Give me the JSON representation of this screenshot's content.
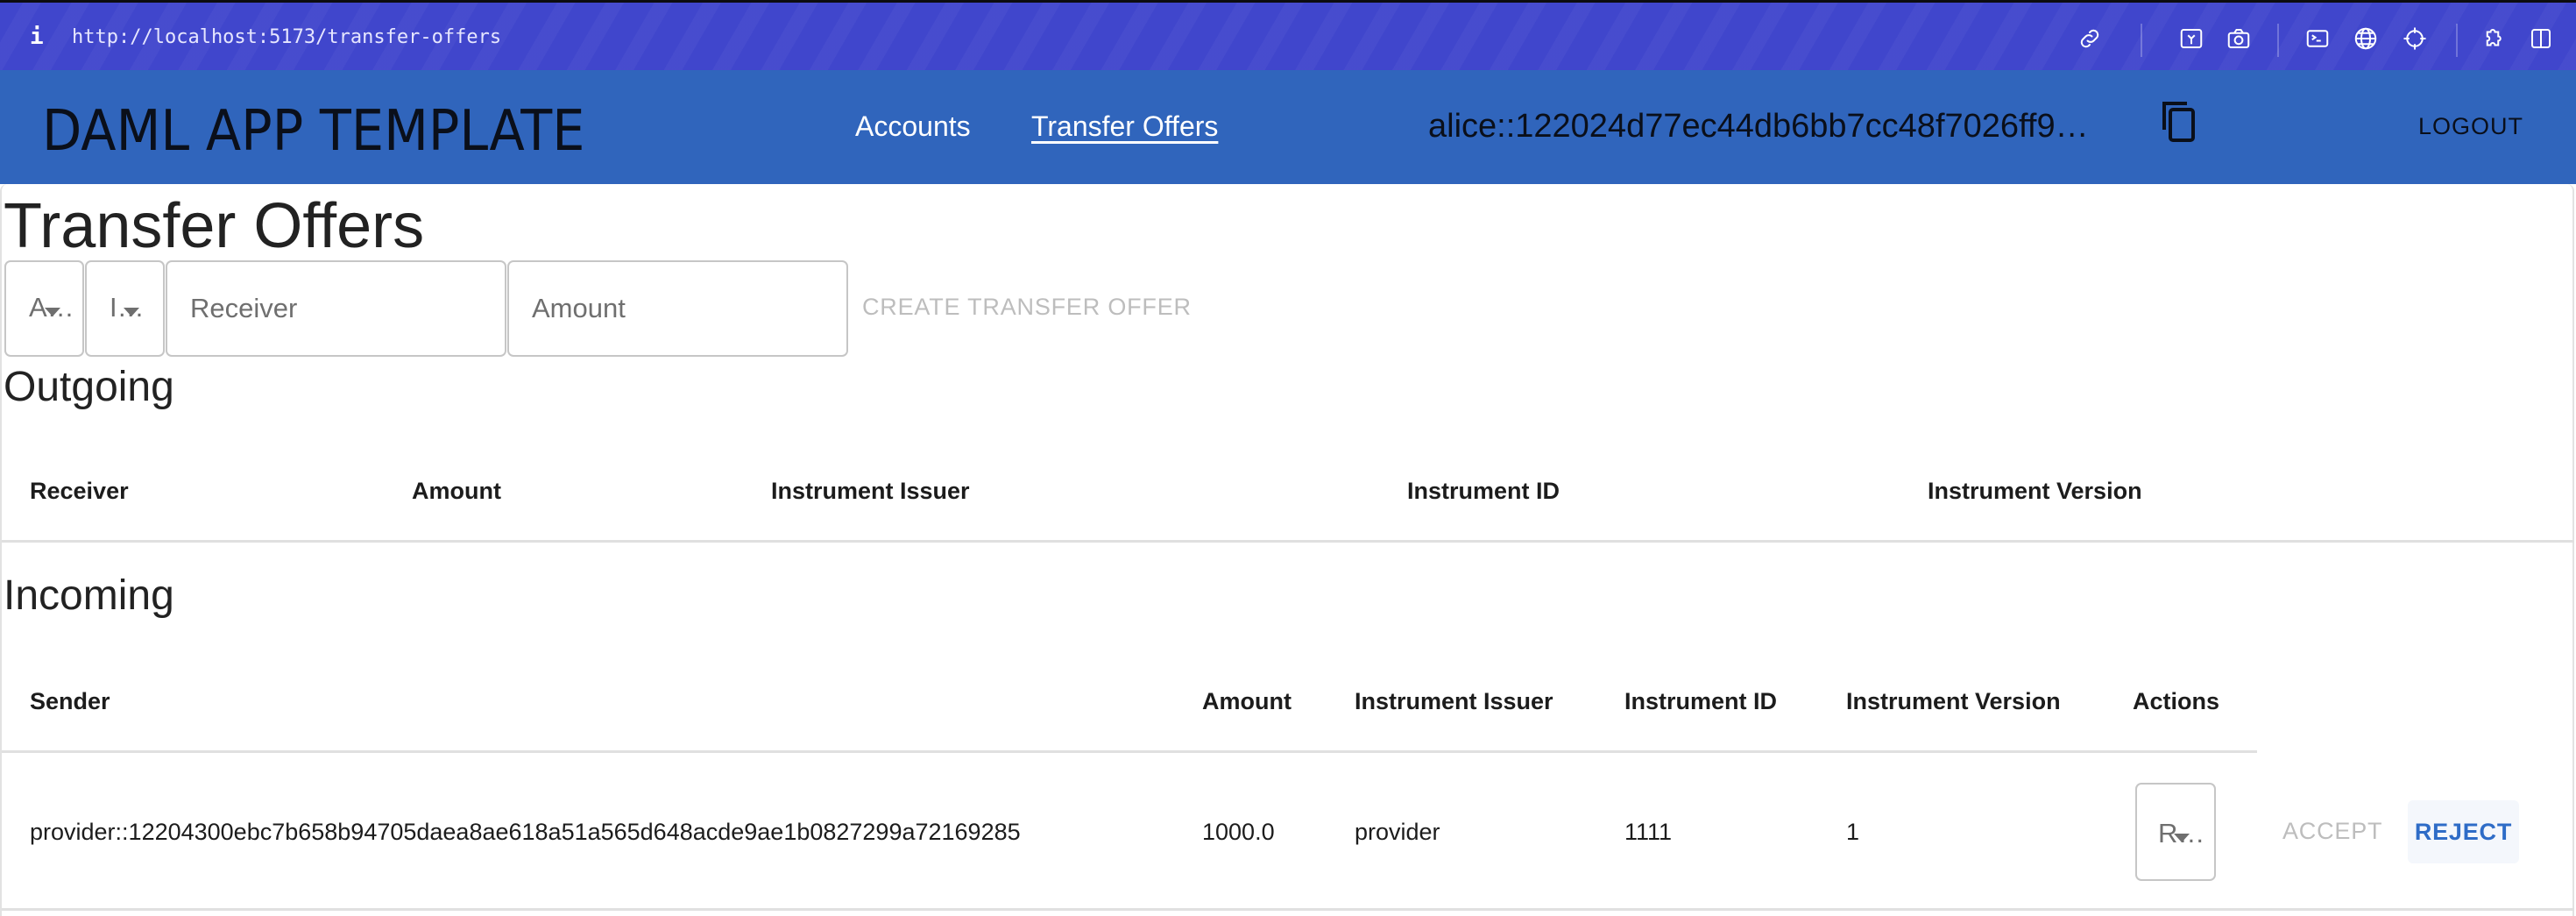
{
  "browser": {
    "url": "http://localhost:5173/transfer-offers",
    "info_icon": "i",
    "toolbar_icons": [
      "link-icon",
      "image-icon",
      "camera-icon",
      "terminal-icon",
      "globe-icon",
      "crosshair-icon",
      "puzzle-icon",
      "sidebar-icon"
    ]
  },
  "header": {
    "app_title": "DAML APP TEMPLATE",
    "nav": [
      {
        "label": "Accounts",
        "active": false
      },
      {
        "label": "Transfer Offers",
        "active": true
      }
    ],
    "party": "alice::122024d77ec44db6bb7cc48f7026ff9…",
    "copy_icon": "copy-icon",
    "logout_label": "LOGOUT"
  },
  "page": {
    "title": "Transfer Offers",
    "form": {
      "account_select_value": "A…",
      "instrument_select_value": "I…",
      "receiver_placeholder": "Receiver",
      "amount_placeholder": "Amount",
      "create_label": "CREATE TRANSFER OFFER"
    },
    "outgoing": {
      "title": "Outgoing",
      "columns": [
        "Receiver",
        "Amount",
        "Instrument Issuer",
        "Instrument ID",
        "Instrument Version"
      ],
      "rows": []
    },
    "incoming": {
      "title": "Incoming",
      "columns": [
        "Sender",
        "Amount",
        "Instrument Issuer",
        "Instrument ID",
        "Instrument Version",
        "Actions"
      ],
      "rows": [
        {
          "sender": "provider::12204300ebc7b658b94705daea8ae618a51a565d648acde9ae1b0827299a72169285",
          "amount": "1000.0",
          "instrument_issuer": "provider",
          "instrument_id": "1111",
          "instrument_version": "1",
          "action_select_value": "R…",
          "accept_label": "ACCEPT",
          "reject_label": "REJECT"
        }
      ]
    }
  },
  "colors": {
    "browser_bar": "#4046cc",
    "header": "#3065bc",
    "primary": "#2e6cc7",
    "disabled": "#bdbdbd"
  }
}
